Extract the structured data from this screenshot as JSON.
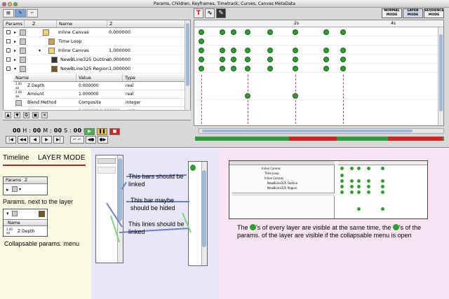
{
  "window": {
    "title": "Params, Children, Keyframes, Timetrack, Curves, Canvas MetaData",
    "left_tabs": [
      "Params",
      "Children",
      "Keyframes"
    ]
  },
  "params_panel": {
    "headers": [
      "Params",
      "Z",
      "Name",
      "Z"
    ],
    "layers": [
      {
        "name": "Inline Canvas",
        "z": "0,000000",
        "indent": 0
      },
      {
        "name": "Time Loop",
        "z": "",
        "indent": 1
      },
      {
        "name": "Inline Canvas",
        "z": "1,000000",
        "indent": 1
      },
      {
        "name": "NewBLine325 Outline",
        "z": "0,000000",
        "indent": 2
      },
      {
        "name": "NewBLine325 Region",
        "z": "1,000000",
        "indent": 2
      }
    ],
    "param_headers": [
      "Name",
      "Value",
      "Type"
    ],
    "param_rows": [
      {
        "name": "Z Depth",
        "value": "0.000000",
        "type": "real"
      },
      {
        "name": "Amount",
        "value": "1.000000",
        "type": "real"
      },
      {
        "name": "Blend Method",
        "value": "Composite",
        "type": "integer"
      },
      {
        "name": "Origin",
        "value": "0.000000,0.000000",
        "type": "vector"
      }
    ]
  },
  "timebar": {
    "hours": "00",
    "minutes": "00",
    "seconds": "00",
    "frames": "00",
    "h_label": "H :",
    "m_label": "M :",
    "s_label": "S :",
    "f_label": "F"
  },
  "right_panel": {
    "tools": [
      "T",
      "curve",
      "pen"
    ],
    "modes": [
      "NORMAL MODE",
      "LAYER MODE",
      "SEQUENCE MODE"
    ],
    "ruler_labels": [
      "2s",
      "4s"
    ]
  },
  "annotations": {
    "timeline": "Timeline",
    "layer_mode": "LAYER MODE",
    "mini_params_header": [
      "Params",
      "Z"
    ],
    "params_next": "Params. next to the layer",
    "mini_name_header": "Name",
    "mini_zdepth": "Z Depth",
    "collapsable": "Collapsable params. menu",
    "bars_linked": "This bars should be linked",
    "bar_hided": "This bar maybe should be hided",
    "lines_linked": "This lines should be linked",
    "bottom_note_a": "The",
    "bottom_note_b": "'s of every layer are visible at the same time, the",
    "bottom_note_c": "'s of the params. of the layer are visible if the collapsable menu is open"
  },
  "colors": {
    "keyframe": "#2e9e2e",
    "progress_green": "#2f9e3a",
    "progress_red": "#d42020",
    "accent_blue": "#7ba7d8"
  }
}
